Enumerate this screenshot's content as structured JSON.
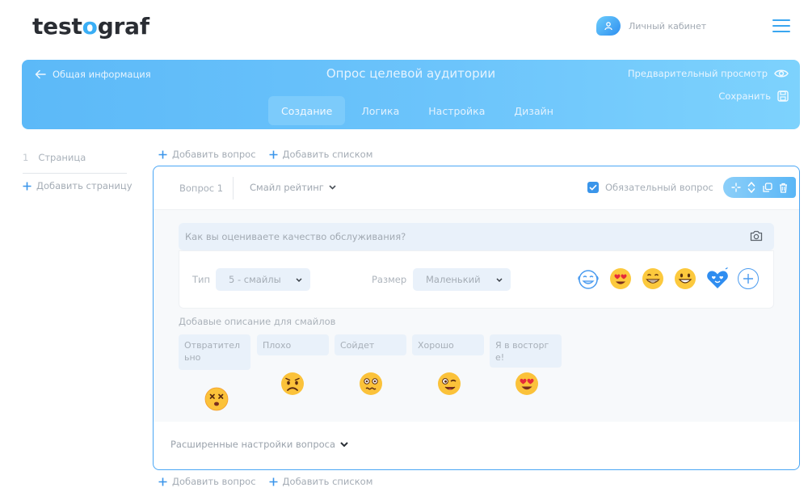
{
  "header": {
    "logo": {
      "part1": "test",
      "part2": "o",
      "part3": "graf"
    },
    "cabinet_label": "Личный кабинет",
    "accent_color": "#3aaef5"
  },
  "banner": {
    "back_label": "Общая информация",
    "title": "Опрос целевой аудитории",
    "preview_label": "Предварительный просмотр",
    "save_label": "Сохранить",
    "tabs": [
      {
        "label": "Создание",
        "active": true
      },
      {
        "label": "Логика",
        "active": false
      },
      {
        "label": "Настройка",
        "active": false
      },
      {
        "label": "Дизайн",
        "active": false
      }
    ]
  },
  "pages": {
    "items": [
      {
        "number": "1",
        "label": "Страница"
      }
    ],
    "add_label": "Добавить страницу"
  },
  "add_bar": {
    "add_question": "Добавить вопрос",
    "add_list": "Добавить списком"
  },
  "question": {
    "number_label": "Вопрос 1",
    "type_label": "Смайл рейтинг",
    "required_label": "Обязательный вопрос",
    "required_checked": true,
    "text": "Как вы оцениваете качество обслуживания?",
    "type_field": {
      "label": "Тип",
      "value": "5 - смайлы"
    },
    "size_field": {
      "label": "Размер",
      "value": "Маленький"
    },
    "emoji_options": [
      "crying-laughing-icon",
      "heart-eyes-icon",
      "grinning-icon",
      "smiling-icon",
      "blue-heart-eyes-icon"
    ],
    "descriptions_title": "Добавые описание для смайлов",
    "descriptions": [
      {
        "text": "Отвратительно",
        "emoji": "dizzy-face-icon"
      },
      {
        "text": "Плохо",
        "emoji": "frowning-face-icon"
      },
      {
        "text": "Сойдет",
        "emoji": "flushed-face-icon"
      },
      {
        "text": "Хорошо",
        "emoji": "winking-face-icon"
      },
      {
        "text": "Я в восторге!",
        "emoji": "heart-eyes-icon"
      }
    ],
    "advanced_label": "Расширенные настройки вопроса"
  }
}
